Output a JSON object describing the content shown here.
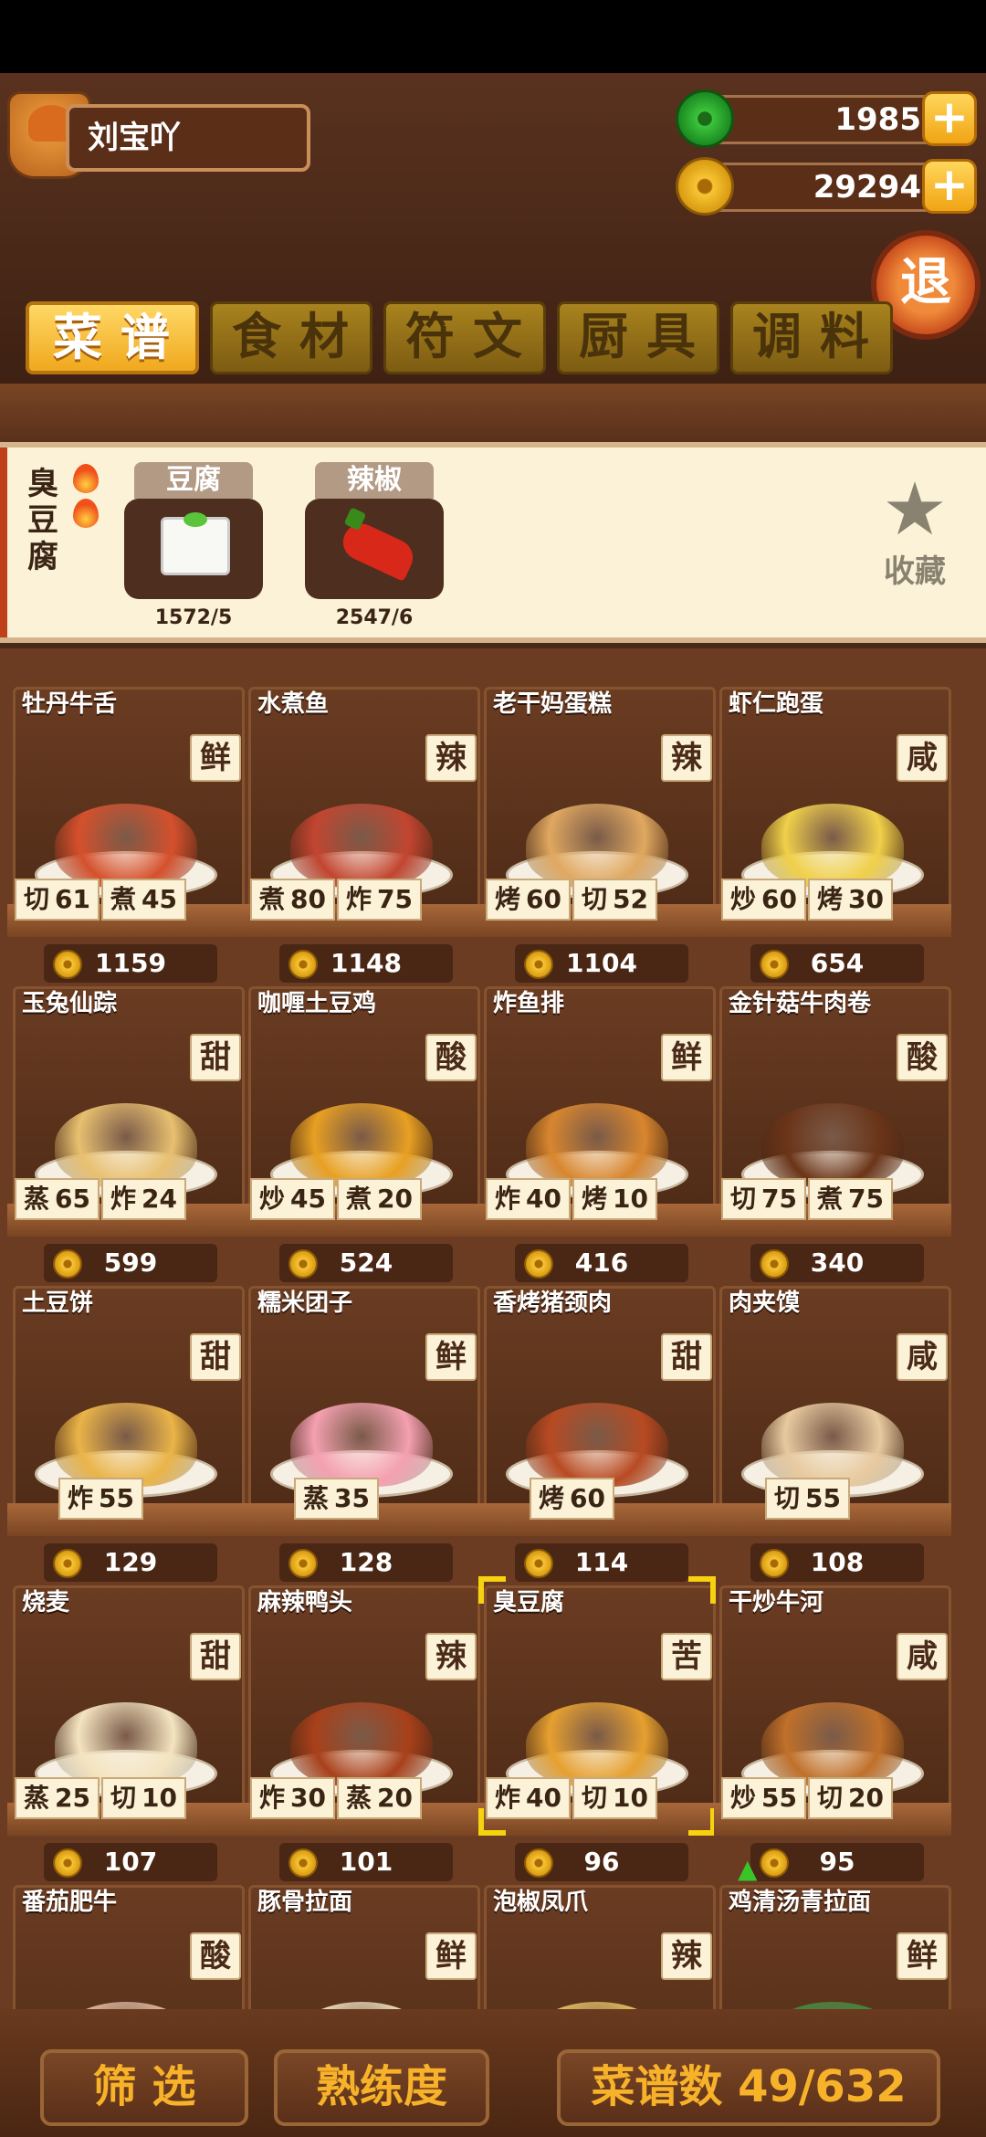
{
  "player": {
    "name": "刘宝吖"
  },
  "currency": {
    "jade": "1985",
    "coins": "29294",
    "plus": "+"
  },
  "exit_label": "退",
  "tabs": [
    {
      "label": "菜谱",
      "active": true
    },
    {
      "label": "食材",
      "active": false
    },
    {
      "label": "符文",
      "active": false
    },
    {
      "label": "厨具",
      "active": false
    },
    {
      "label": "调料",
      "active": false
    }
  ],
  "selected_recipe": {
    "name": "臭豆腐",
    "rarity_flames": 2,
    "ingredients": [
      {
        "name": "豆腐",
        "count": "1572/5",
        "icon": "tofu-icon"
      },
      {
        "name": "辣椒",
        "count": "2547/6",
        "icon": "chili-pepper-icon"
      }
    ],
    "favorite_label": "收藏",
    "favorite_icon": "star-icon"
  },
  "recipes": [
    {
      "name": "牡丹牛舌",
      "flavor": "鲜",
      "skills": [
        [
          "切",
          "61"
        ],
        [
          "煮",
          "45"
        ]
      ],
      "price": "1159",
      "color": "#d5502c"
    },
    {
      "name": "水煮鱼",
      "flavor": "辣",
      "skills": [
        [
          "煮",
          "80"
        ],
        [
          "炸",
          "75"
        ]
      ],
      "price": "1148",
      "color": "#c24530"
    },
    {
      "name": "老干妈蛋糕",
      "flavor": "辣",
      "skills": [
        [
          "烤",
          "60"
        ],
        [
          "切",
          "52"
        ]
      ],
      "price": "1104",
      "color": "#e0a860"
    },
    {
      "name": "虾仁跑蛋",
      "flavor": "咸",
      "skills": [
        [
          "炒",
          "60"
        ],
        [
          "烤",
          "30"
        ]
      ],
      "price": "654",
      "color": "#f0d04a"
    },
    {
      "name": "玉兔仙踪",
      "flavor": "甜",
      "skills": [
        [
          "蒸",
          "65"
        ],
        [
          "炸",
          "24"
        ]
      ],
      "price": "599",
      "color": "#e8c070"
    },
    {
      "name": "咖喱土豆鸡",
      "flavor": "酸",
      "skills": [
        [
          "炒",
          "45"
        ],
        [
          "煮",
          "20"
        ]
      ],
      "price": "524",
      "color": "#e8a022"
    },
    {
      "name": "炸鱼排",
      "flavor": "鲜",
      "skills": [
        [
          "炸",
          "40"
        ],
        [
          "烤",
          "10"
        ]
      ],
      "price": "416",
      "color": "#d8862e"
    },
    {
      "name": "金针菇牛肉卷",
      "flavor": "酸",
      "skills": [
        [
          "切",
          "75"
        ],
        [
          "煮",
          "75"
        ]
      ],
      "price": "340",
      "color": "#6a3418"
    },
    {
      "name": "土豆饼",
      "flavor": "甜",
      "skills": [
        [
          "炸",
          "55"
        ]
      ],
      "price": "129",
      "color": "#eab448"
    },
    {
      "name": "糯米团子",
      "flavor": "鲜",
      "skills": [
        [
          "蒸",
          "35"
        ]
      ],
      "price": "128",
      "color": "#f4a0b0"
    },
    {
      "name": "香烤猪颈肉",
      "flavor": "甜",
      "skills": [
        [
          "烤",
          "60"
        ]
      ],
      "price": "114",
      "color": "#b84a22"
    },
    {
      "name": "肉夹馍",
      "flavor": "咸",
      "skills": [
        [
          "切",
          "55"
        ]
      ],
      "price": "108",
      "color": "#e8caa0"
    },
    {
      "name": "烧麦",
      "flavor": "甜",
      "skills": [
        [
          "蒸",
          "25"
        ],
        [
          "切",
          "10"
        ]
      ],
      "price": "107",
      "color": "#f4e4c0"
    },
    {
      "name": "麻辣鸭头",
      "flavor": "辣",
      "skills": [
        [
          "炸",
          "30"
        ],
        [
          "蒸",
          "20"
        ]
      ],
      "price": "101",
      "color": "#a8401a"
    },
    {
      "name": "臭豆腐",
      "flavor": "苦",
      "skills": [
        [
          "炸",
          "40"
        ],
        [
          "切",
          "10"
        ]
      ],
      "price": "96",
      "color": "#e6a030",
      "selected": true
    },
    {
      "name": "干炒牛河",
      "flavor": "咸",
      "skills": [
        [
          "炒",
          "55"
        ],
        [
          "切",
          "20"
        ]
      ],
      "price": "95",
      "color": "#c0702a",
      "price_up": true
    },
    {
      "name": "番茄肥牛",
      "flavor": "酸",
      "skills": [],
      "price": "",
      "color": "#e0b8a0"
    },
    {
      "name": "豚骨拉面",
      "flavor": "鲜",
      "skills": [],
      "price": "",
      "color": "#f0e0c0"
    },
    {
      "name": "泡椒凤爪",
      "flavor": "辣",
      "skills": [],
      "price": "",
      "color": "#e8c060"
    },
    {
      "name": "鸡清汤青拉面",
      "flavor": "鲜",
      "skills": [],
      "price": "",
      "color": "#3a8a3a"
    }
  ],
  "bottom": {
    "filter_label": "筛 选",
    "proficiency_label": "熟练度",
    "recipe_count_label": "菜谱数 49/632"
  }
}
